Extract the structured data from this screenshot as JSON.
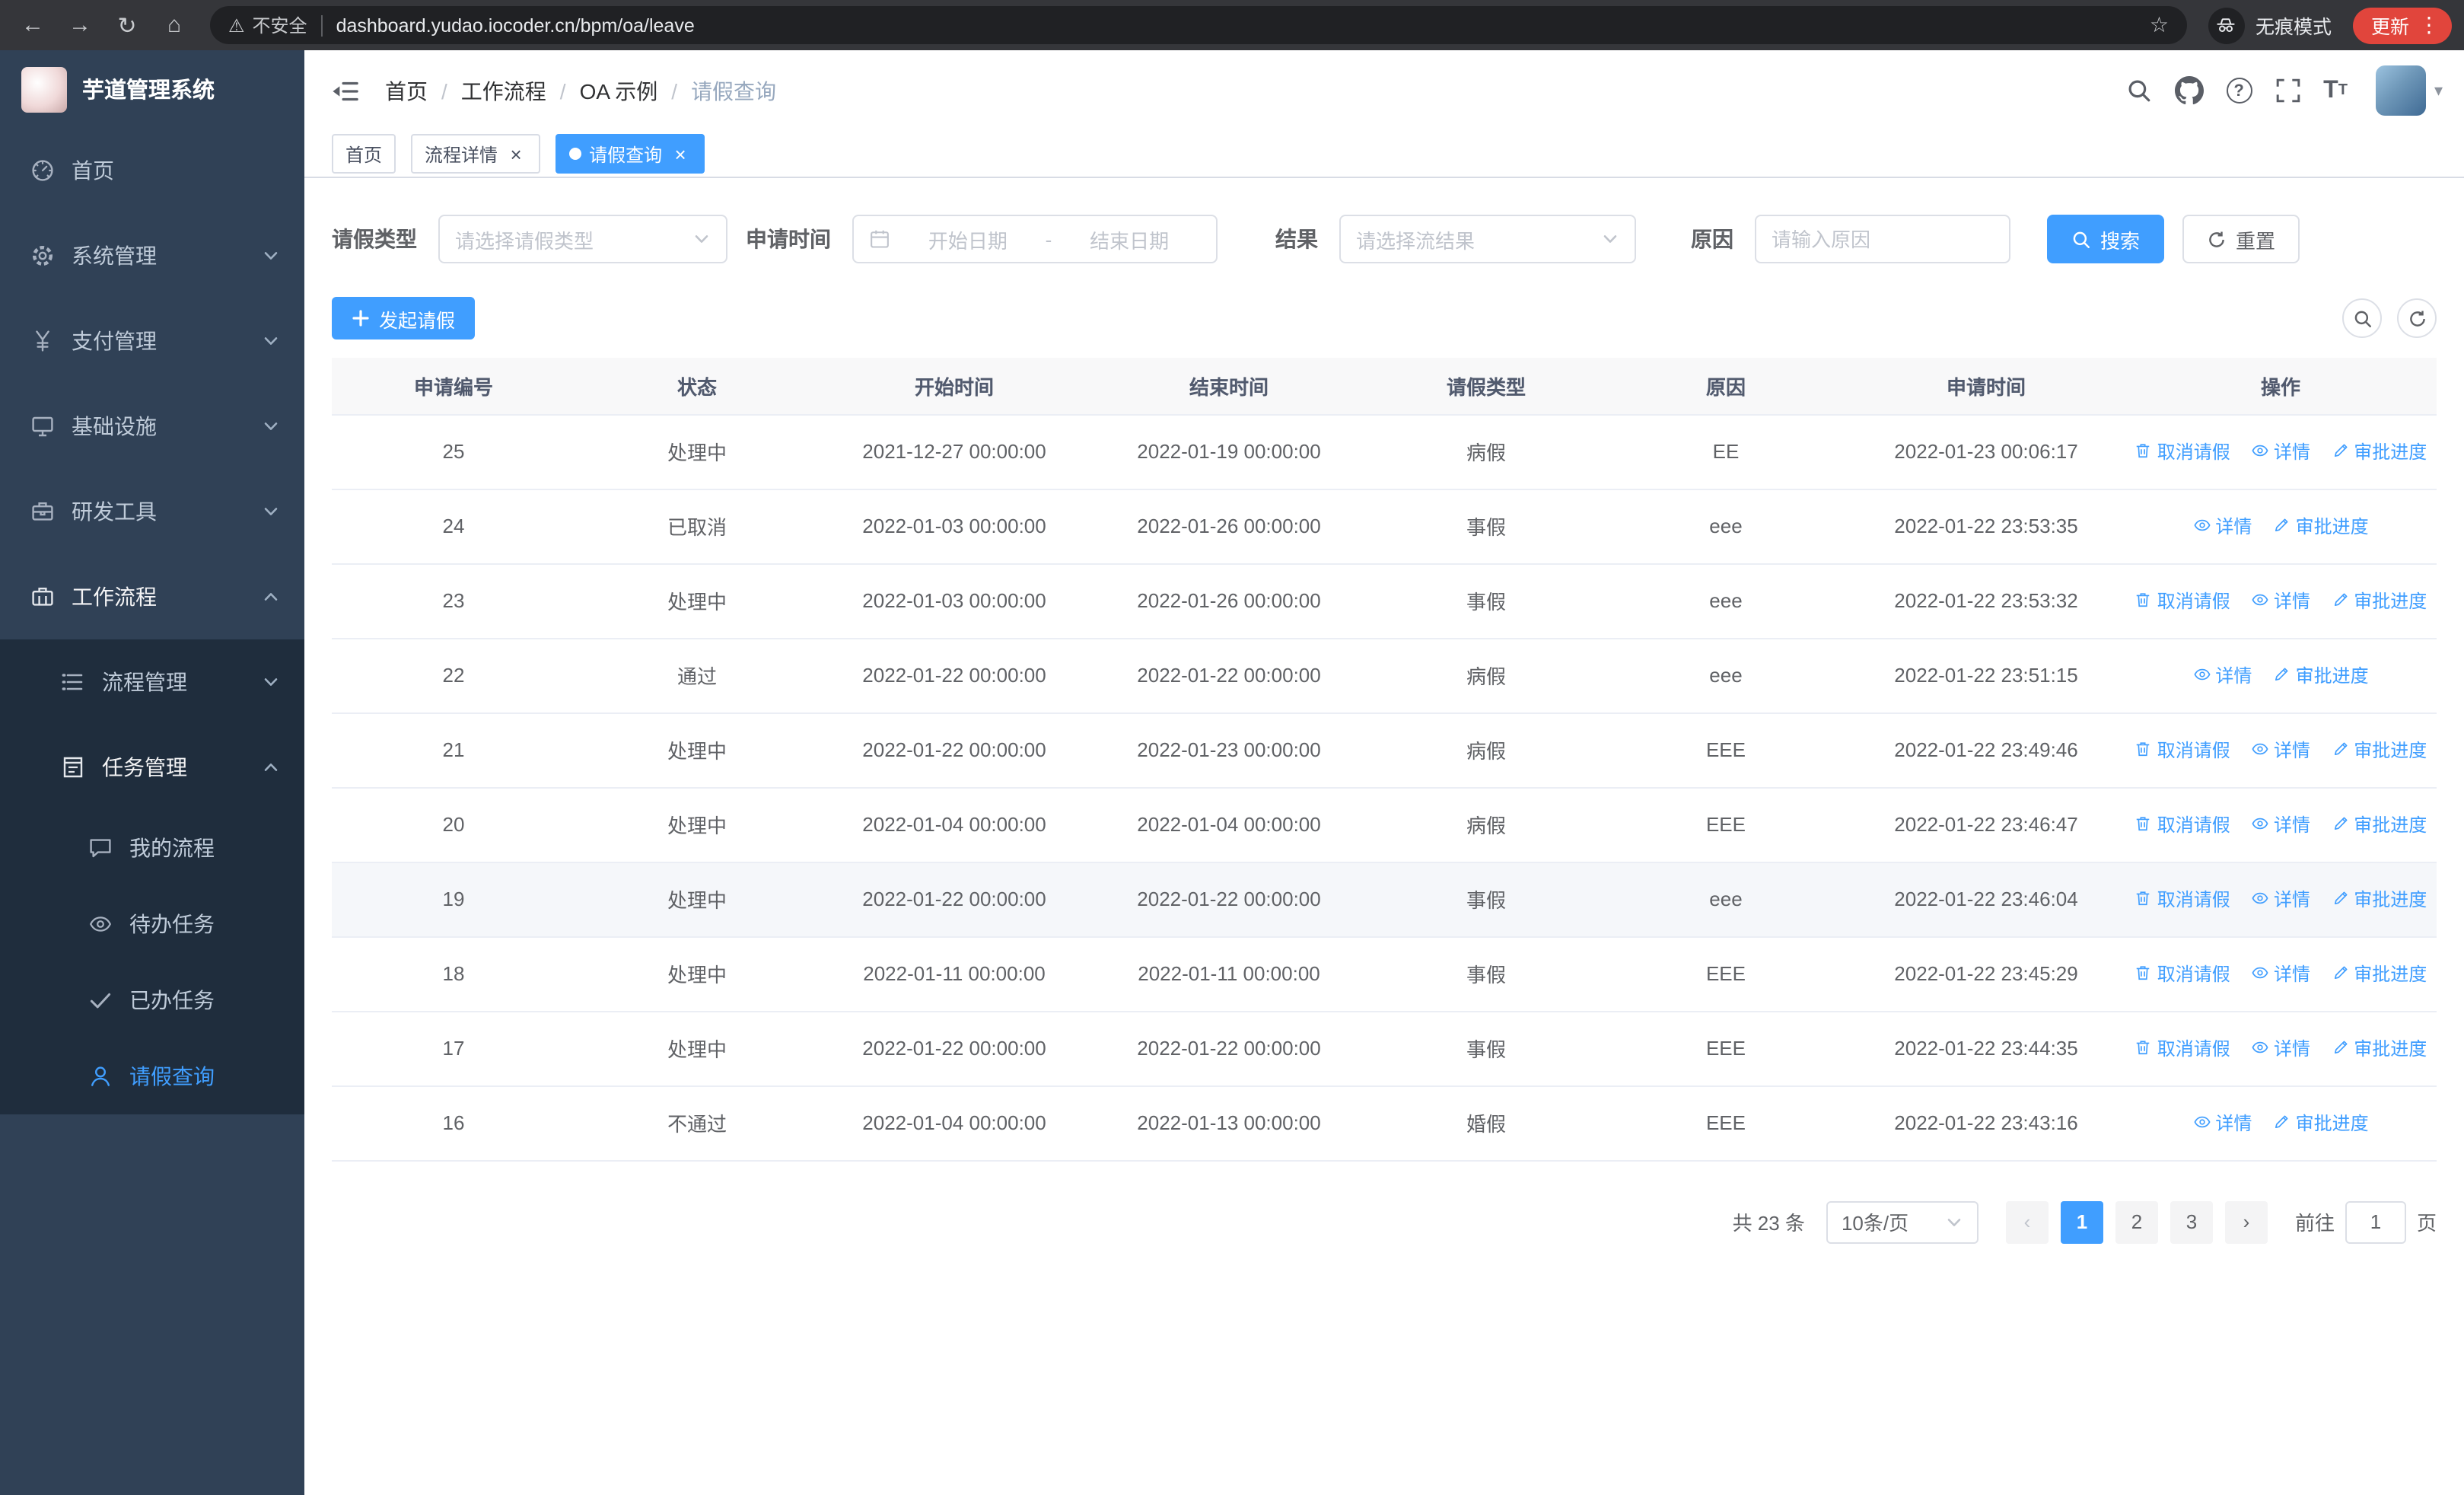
{
  "browser": {
    "warning": "不安全",
    "url": "dashboard.yudao.iocoder.cn/bpm/oa/leave",
    "incognito": "无痕模式",
    "update": "更新"
  },
  "sidebar": {
    "title": "芋道管理系统",
    "menu": [
      {
        "name": "home",
        "label": "首页",
        "icon": "dashboard-icon",
        "level": 1
      },
      {
        "name": "system-management",
        "label": "系统管理",
        "icon": "gear-icon",
        "level": 1,
        "children": "collapsed"
      },
      {
        "name": "payment-management",
        "label": "支付管理",
        "icon": "yen-icon",
        "level": 1,
        "children": "collapsed"
      },
      {
        "name": "infrastructure",
        "label": "基础设施",
        "icon": "monitor-icon",
        "level": 1,
        "children": "collapsed"
      },
      {
        "name": "dev-tools",
        "label": "研发工具",
        "icon": "toolbox-icon",
        "level": 1,
        "children": "collapsed"
      },
      {
        "name": "workflow",
        "label": "工作流程",
        "icon": "suitcase-icon",
        "level": 1,
        "children": "expanded"
      },
      {
        "name": "process-management",
        "label": "流程管理",
        "icon": "flow-icon",
        "level": 2,
        "children": "collapsed"
      },
      {
        "name": "task-management",
        "label": "任务管理",
        "icon": "task-icon",
        "level": 2,
        "children": "expanded"
      },
      {
        "name": "my-processes",
        "label": "我的流程",
        "icon": "chat-icon",
        "level": 3
      },
      {
        "name": "todo-tasks",
        "label": "待办任务",
        "icon": "eye-icon",
        "level": 3
      },
      {
        "name": "done-tasks",
        "label": "已办任务",
        "icon": "check-icon",
        "level": 3
      },
      {
        "name": "leave-query",
        "label": "请假查询",
        "icon": "user-icon",
        "level": 3,
        "active": true
      }
    ]
  },
  "navbar": {
    "separator": "/",
    "breadcrumb": [
      {
        "label": "首页"
      },
      {
        "label": "工作流程"
      },
      {
        "label": "OA 示例"
      },
      {
        "label": "请假查询",
        "current": true
      }
    ]
  },
  "tabs": [
    {
      "label": "首页",
      "closable": false,
      "active": false
    },
    {
      "label": "流程详情",
      "closable": true,
      "active": false
    },
    {
      "label": "请假查询",
      "closable": true,
      "active": true
    }
  ],
  "filters": {
    "leave_type": {
      "label": "请假类型",
      "placeholder": "请选择请假类型"
    },
    "apply_time": {
      "label": "申请时间",
      "start_placeholder": "开始日期",
      "separator": "-",
      "end_placeholder": "结束日期"
    },
    "result": {
      "label": "结果",
      "placeholder": "请选择流结果"
    },
    "reason": {
      "label": "原因",
      "placeholder": "请输入原因"
    },
    "search": "搜索",
    "reset": "重置"
  },
  "toolbar": {
    "create": "发起请假"
  },
  "table": {
    "columns": [
      "申请编号",
      "状态",
      "开始时间",
      "结束时间",
      "请假类型",
      "原因",
      "申请时间",
      "操作"
    ],
    "actions": {
      "cancel": "取消请假",
      "detail": "详情",
      "progress": "审批进度"
    },
    "rows": [
      {
        "id": "25",
        "status": "处理中",
        "start": "2021-12-27 00:00:00",
        "end": "2022-01-19 00:00:00",
        "type": "病假",
        "reason": "EE",
        "applied": "2022-01-23 00:06:17",
        "cancelable": true,
        "highlight": false
      },
      {
        "id": "24",
        "status": "已取消",
        "start": "2022-01-03 00:00:00",
        "end": "2022-01-26 00:00:00",
        "type": "事假",
        "reason": "eee",
        "applied": "2022-01-22 23:53:35",
        "cancelable": false,
        "highlight": false
      },
      {
        "id": "23",
        "status": "处理中",
        "start": "2022-01-03 00:00:00",
        "end": "2022-01-26 00:00:00",
        "type": "事假",
        "reason": "eee",
        "applied": "2022-01-22 23:53:32",
        "cancelable": true,
        "highlight": false
      },
      {
        "id": "22",
        "status": "通过",
        "start": "2022-01-22 00:00:00",
        "end": "2022-01-22 00:00:00",
        "type": "病假",
        "reason": "eee",
        "applied": "2022-01-22 23:51:15",
        "cancelable": false,
        "highlight": false
      },
      {
        "id": "21",
        "status": "处理中",
        "start": "2022-01-22 00:00:00",
        "end": "2022-01-23 00:00:00",
        "type": "病假",
        "reason": "EEE",
        "applied": "2022-01-22 23:49:46",
        "cancelable": true,
        "highlight": false
      },
      {
        "id": "20",
        "status": "处理中",
        "start": "2022-01-04 00:00:00",
        "end": "2022-01-04 00:00:00",
        "type": "病假",
        "reason": "EEE",
        "applied": "2022-01-22 23:46:47",
        "cancelable": true,
        "highlight": false
      },
      {
        "id": "19",
        "status": "处理中",
        "start": "2022-01-22 00:00:00",
        "end": "2022-01-22 00:00:00",
        "type": "事假",
        "reason": "eee",
        "applied": "2022-01-22 23:46:04",
        "cancelable": true,
        "highlight": true
      },
      {
        "id": "18",
        "status": "处理中",
        "start": "2022-01-11 00:00:00",
        "end": "2022-01-11 00:00:00",
        "type": "事假",
        "reason": "EEE",
        "applied": "2022-01-22 23:45:29",
        "cancelable": true,
        "highlight": false
      },
      {
        "id": "17",
        "status": "处理中",
        "start": "2022-01-22 00:00:00",
        "end": "2022-01-22 00:00:00",
        "type": "事假",
        "reason": "EEE",
        "applied": "2022-01-22 23:44:35",
        "cancelable": true,
        "highlight": false
      },
      {
        "id": "16",
        "status": "不通过",
        "start": "2022-01-04 00:00:00",
        "end": "2022-01-13 00:00:00",
        "type": "婚假",
        "reason": "EEE",
        "applied": "2022-01-22 23:43:16",
        "cancelable": false,
        "highlight": false
      }
    ]
  },
  "pagination": {
    "total": "共 23 条",
    "page_size": "10条/页",
    "pages": [
      "1",
      "2",
      "3"
    ],
    "active": "1",
    "goto": "前往",
    "goto_value": "1",
    "unit": "页"
  },
  "colors": {
    "primary": "#409eff",
    "sidebar_bg": "#304156",
    "submenu_bg": "#1f2d3d"
  }
}
